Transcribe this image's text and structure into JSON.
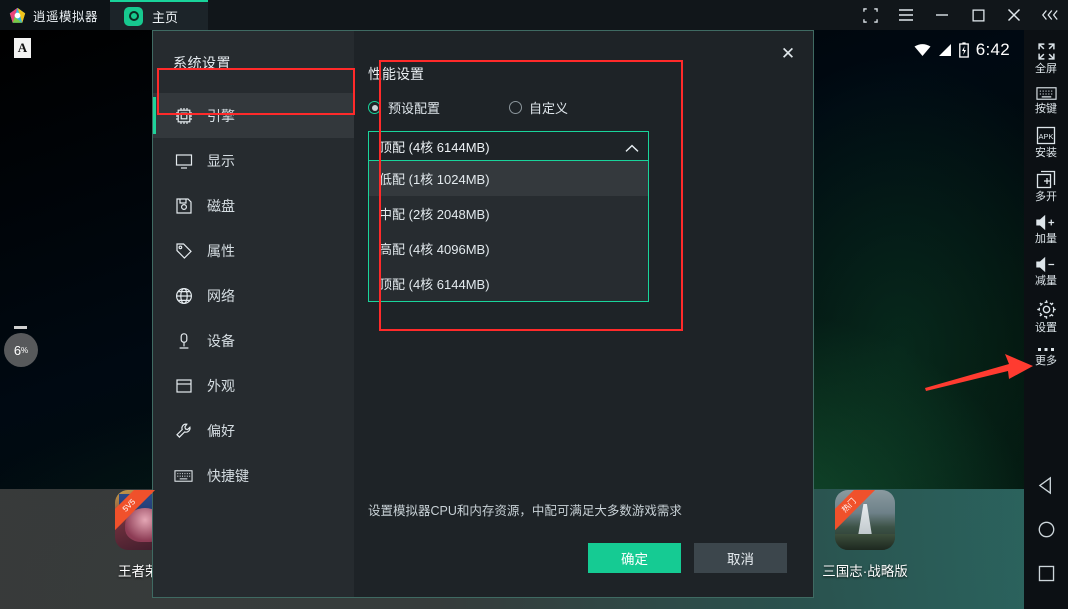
{
  "titlebar": {
    "brand_name": "逍遥模拟器",
    "tab_label": "主页",
    "buttons": [
      {
        "name": "screenshot-crop-button",
        "glyph": "crop"
      },
      {
        "name": "menu-button",
        "glyph": "menu"
      },
      {
        "name": "minimize-button",
        "glyph": "minimize"
      },
      {
        "name": "maximize-button",
        "glyph": "maximize"
      },
      {
        "name": "close-button",
        "glyph": "close"
      },
      {
        "name": "collapse-toolbar-button",
        "glyph": "chevrons-left"
      }
    ]
  },
  "screen": {
    "badge_letter": "A",
    "fps_value": "6",
    "fps_unit": "%",
    "status_clock": "6:42",
    "apps": [
      {
        "label": "王者荣耀",
        "ribbon": "5V5"
      },
      {
        "label": "三国志·战略版",
        "ribbon": "热门"
      }
    ]
  },
  "right_toolbar": {
    "items": [
      {
        "label": "全屏",
        "icon": "fullscreen-icon"
      },
      {
        "label": "按键",
        "icon": "keyboard-icon"
      },
      {
        "label": "安装",
        "icon": "apk-install-icon"
      },
      {
        "label": "多开",
        "icon": "multi-instance-icon"
      },
      {
        "label": "加量",
        "icon": "volume-up-icon"
      },
      {
        "label": "减量",
        "icon": "volume-down-icon"
      },
      {
        "label": "设置",
        "icon": "gear-icon"
      },
      {
        "label": "更多",
        "icon": "more-dots-icon"
      }
    ],
    "nav": [
      {
        "name": "android-back-button",
        "icon": "triangle-back-icon"
      },
      {
        "name": "android-home-button",
        "icon": "circle-home-icon"
      },
      {
        "name": "android-recents-button",
        "icon": "square-recents-icon"
      }
    ]
  },
  "dialog": {
    "title": "系统设置",
    "close_glyph": "✕",
    "sidebar": [
      {
        "label": "引擎",
        "icon": "cpu-icon",
        "active": true
      },
      {
        "label": "显示",
        "icon": "monitor-icon",
        "active": false
      },
      {
        "label": "磁盘",
        "icon": "disk-icon",
        "active": false
      },
      {
        "label": "属性",
        "icon": "tag-icon",
        "active": false
      },
      {
        "label": "网络",
        "icon": "globe-icon",
        "active": false
      },
      {
        "label": "设备",
        "icon": "device-icon",
        "active": false
      },
      {
        "label": "外观",
        "icon": "window-icon",
        "active": false
      },
      {
        "label": "偏好",
        "icon": "wrench-icon",
        "active": false
      },
      {
        "label": "快捷键",
        "icon": "keyboard-icon",
        "active": false
      }
    ],
    "performance": {
      "section_title": "性能设置",
      "radios": [
        {
          "label": "预设配置",
          "selected": true
        },
        {
          "label": "自定义",
          "selected": false
        }
      ],
      "combo_value": "顶配 (4核 6144MB)",
      "combo_expanded": true,
      "options": [
        {
          "label": "低配 (1核 1024MB)",
          "highlighted": true
        },
        {
          "label": "中配 (2核 2048MB)",
          "highlighted": false
        },
        {
          "label": "高配 (4核 4096MB)",
          "highlighted": false
        },
        {
          "label": "顶配 (4核 6144MB)",
          "highlighted": false
        }
      ]
    },
    "hint": "设置模拟器CPU和内存资源，中配可满足大多数游戏需求",
    "ok_label": "确定",
    "cancel_label": "取消"
  },
  "annotations": {
    "highlight_color": "#ff2a2a",
    "boxes": [
      "engine-menu-item",
      "performance-settings-panel"
    ],
    "arrow_target": "settings-gear-button"
  },
  "colors": {
    "accent_green": "#19d49b",
    "dialog_bg": "#1e2327",
    "sidebar_bg": "#262b2f",
    "titlebar_bg": "#11161a",
    "annotation_red": "#ff2a2a"
  }
}
